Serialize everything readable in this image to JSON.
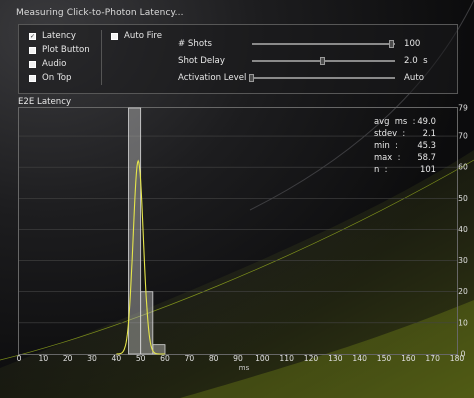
{
  "window": {
    "title": "Measuring  Click-to-Photon  Latency..."
  },
  "options": {
    "checkboxes": [
      {
        "label": "Latency",
        "checked": true
      },
      {
        "label": "Plot Button",
        "checked": false
      },
      {
        "label": "Audio",
        "checked": false
      },
      {
        "label": "On Top",
        "checked": false
      }
    ],
    "auto_fire": {
      "label": "Auto Fire",
      "checked": false
    },
    "sliders": [
      {
        "label": "# Shots",
        "value": "100",
        "level": 1.0
      },
      {
        "label": "Shot Delay",
        "value": "2.0  s",
        "level": 0.5
      },
      {
        "label": "Activation Level",
        "value": "Auto",
        "level": 0.0
      }
    ]
  },
  "stats": [
    {
      "name": "avg  ms  :",
      "value": "49.0"
    },
    {
      "name": "stdev  :",
      "value": "2.1"
    },
    {
      "name": "min  :",
      "value": "45.3"
    },
    {
      "name": "max  :",
      "value": "58.7"
    },
    {
      "name": "n  :",
      "value": "101"
    }
  ],
  "colors": {
    "histogram": "#bdbdbd",
    "curve": "#e6e64a",
    "grid": "#444444",
    "accent": "#a8c41c"
  },
  "chart_data": {
    "type": "bar",
    "title": "E2E  Latency",
    "xlabel": "ms",
    "ylabel": "",
    "xlim": [
      0,
      180
    ],
    "ylim": [
      0,
      79
    ],
    "x_ticks": [
      0,
      10,
      20,
      30,
      40,
      50,
      60,
      70,
      80,
      90,
      100,
      110,
      120,
      130,
      140,
      150,
      160,
      170,
      180
    ],
    "y_ticks": [
      0,
      10,
      20,
      30,
      40,
      50,
      60,
      70,
      79
    ],
    "bins": [
      {
        "start": 45,
        "end": 50,
        "value": 79
      },
      {
        "start": 50,
        "end": 55,
        "value": 20
      },
      {
        "start": 55,
        "end": 60,
        "value": 3
      }
    ],
    "curve": {
      "type": "gaussian",
      "mean": 49.0,
      "stdev": 2.1,
      "peak": 62
    }
  }
}
